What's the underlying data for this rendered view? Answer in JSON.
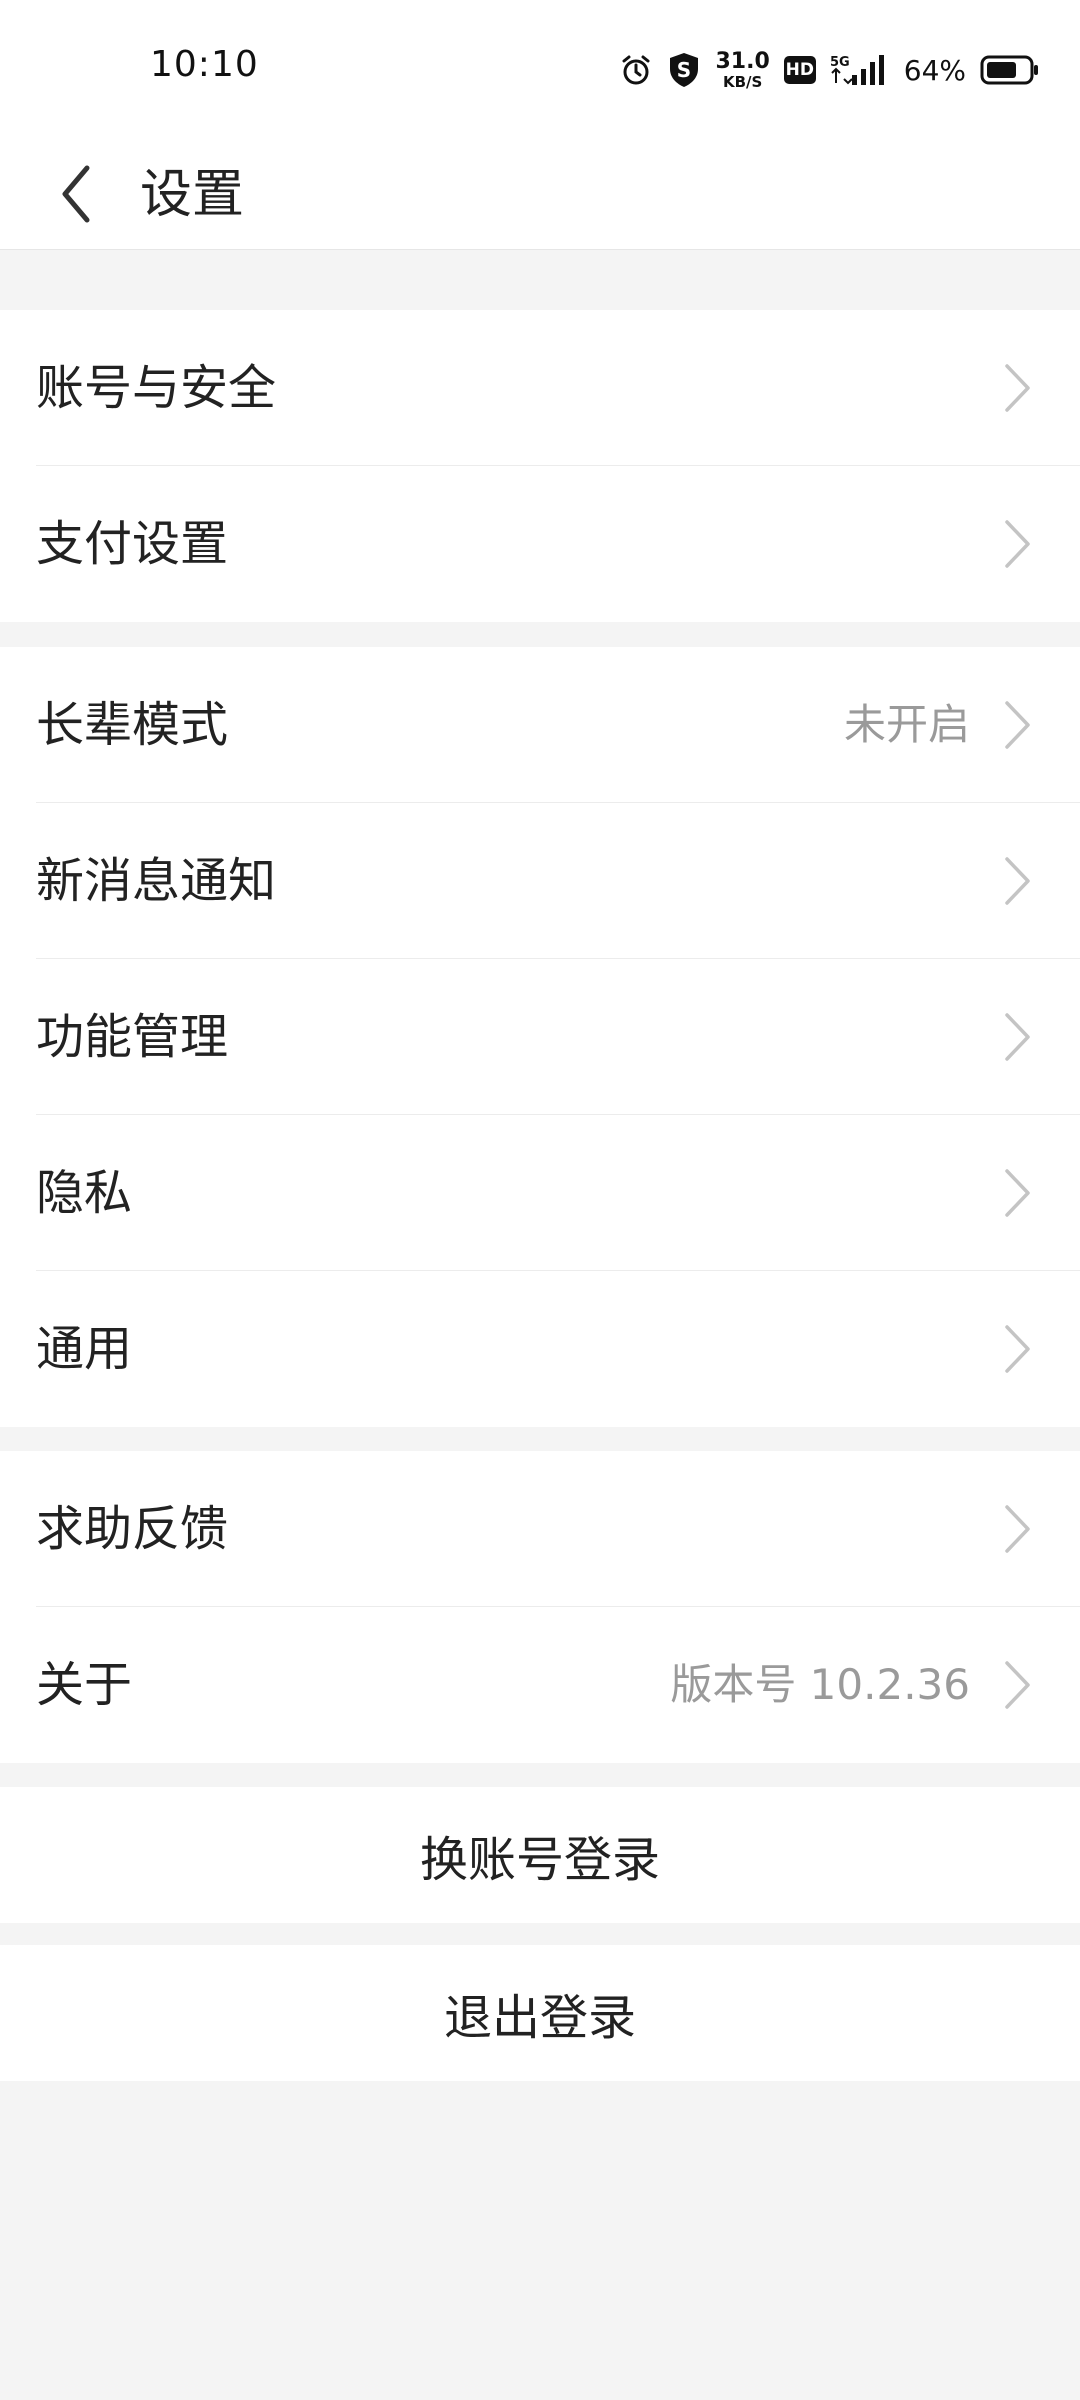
{
  "status_bar": {
    "time": "10:10",
    "net_speed_value": "31.0",
    "net_speed_unit": "KB/S",
    "hd_label": "HD",
    "network_type": "5G",
    "battery_percent": "64%",
    "icons": [
      "alarm-icon",
      "shield-s-icon",
      "hd-icon",
      "signal-icon",
      "battery-icon"
    ]
  },
  "header": {
    "title": "设置",
    "back_icon": "chevron-left-icon"
  },
  "groups": [
    {
      "items": [
        {
          "label": "账号与安全",
          "value": ""
        },
        {
          "label": "支付设置",
          "value": ""
        }
      ]
    },
    {
      "items": [
        {
          "label": "长辈模式",
          "value": "未开启"
        },
        {
          "label": "新消息通知",
          "value": ""
        },
        {
          "label": "功能管理",
          "value": ""
        },
        {
          "label": "隐私",
          "value": ""
        },
        {
          "label": "通用",
          "value": ""
        }
      ]
    },
    {
      "items": [
        {
          "label": "求助反馈",
          "value": ""
        },
        {
          "label": "关于",
          "value": "版本号 10.2.36"
        }
      ]
    }
  ],
  "actions": {
    "switch_account": "换账号登录",
    "logout": "退出登录"
  },
  "colors": {
    "background": "#f4f4f4",
    "surface": "#ffffff",
    "text_primary": "#222222",
    "text_secondary": "#9a9a9a",
    "chevron": "#c4c4c4",
    "divider": "#ececec"
  }
}
